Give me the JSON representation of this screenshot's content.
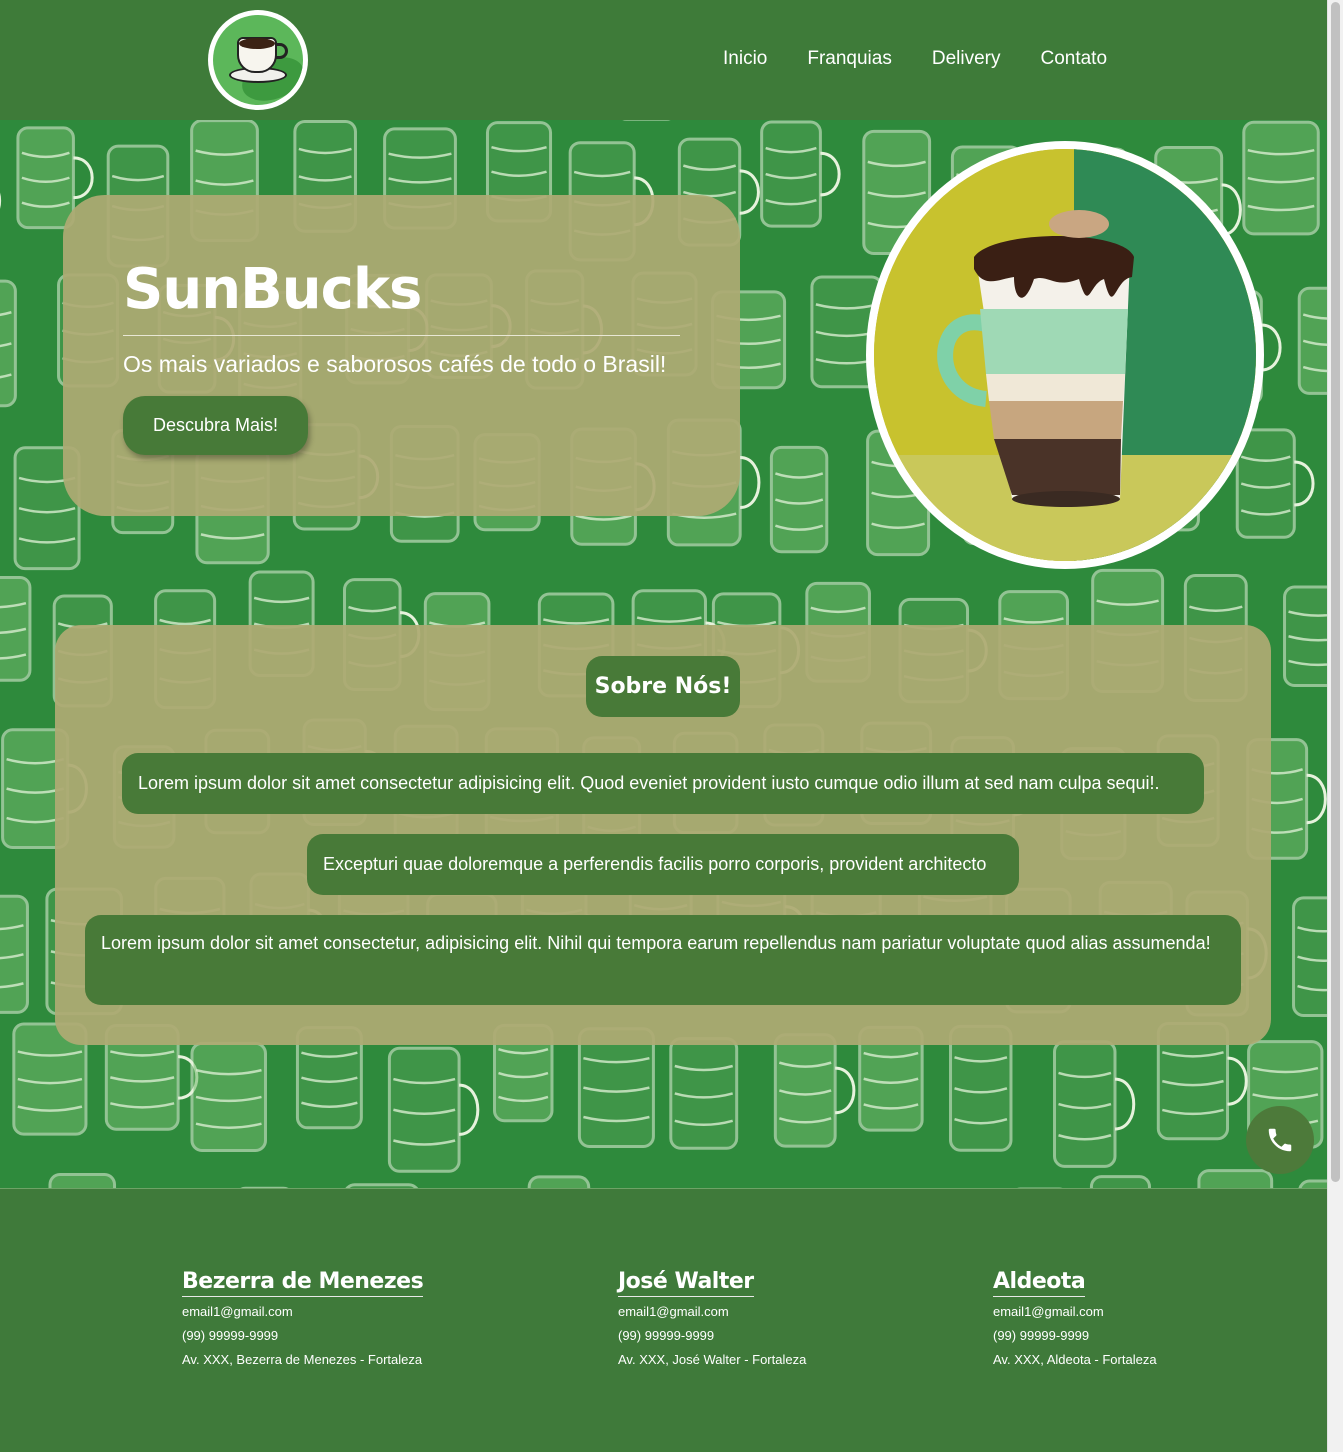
{
  "nav": {
    "items": [
      "Inicio",
      "Franquias",
      "Delivery",
      "Contato"
    ]
  },
  "hero": {
    "title": "SunBucks",
    "subtitle": "Os mais variados e saborosos cafés de todo o Brasil!",
    "button": "Descubra Mais!"
  },
  "about": {
    "title": "Sobre Nós!",
    "paragraphs": [
      "Lorem ipsum dolor sit amet consectetur adipisicing elit. Quod eveniet provident iusto cumque odio illum at sed nam culpa sequi!.",
      "Excepturi quae doloremque a perferendis facilis porro corporis, provident architecto",
      "Lorem ipsum dolor sit amet consectetur, adipisicing elit. Nihil qui tempora earum repellendus nam pariatur voluptate quod alias assumenda!"
    ]
  },
  "locations": [
    {
      "name": "Bezerra de Menezes",
      "email": "email1@gmail.com",
      "phone": "(99) 99999-9999",
      "address": "Av. XXX, Bezerra de Menezes - Fortaleza"
    },
    {
      "name": "José Walter",
      "email": "email1@gmail.com",
      "phone": "(99) 99999-9999",
      "address": "Av. XXX, José Walter - Fortaleza"
    },
    {
      "name": "Aldeota",
      "email": "email1@gmail.com",
      "phone": "(99) 99999-9999",
      "address": "Av. XXX, Aldeota - Fortaleza"
    }
  ],
  "icons": {
    "logo": "coffee-cup-icon",
    "phone": "phone-icon"
  },
  "colors": {
    "header": "#3e7b39",
    "accent": "#487a38",
    "card": "#adaa73",
    "pattern": "#2e8a3c"
  }
}
